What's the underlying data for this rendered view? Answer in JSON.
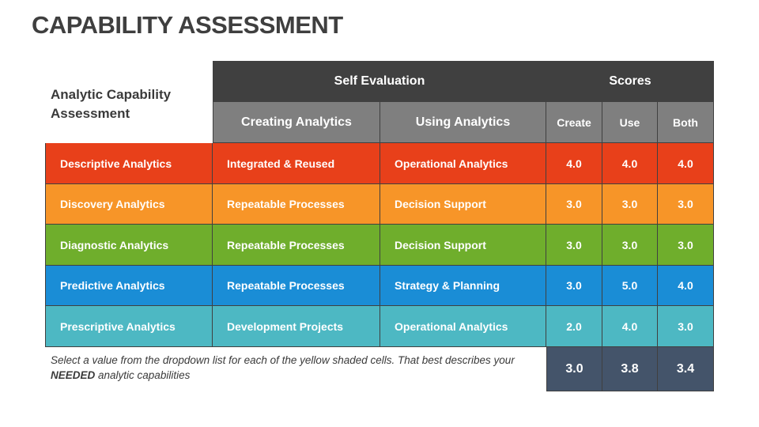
{
  "title": "CAPABILITY ASSESSMENT",
  "side_heading": "Analytic Capability Assessment",
  "headers": {
    "self_evaluation": "Self Evaluation",
    "scores": "Scores",
    "creating": "Creating Analytics",
    "using": "Using Analytics",
    "create": "Create",
    "use": "Use",
    "both": "Both"
  },
  "rows": [
    {
      "name": "Descriptive Analytics",
      "creating": "Integrated & Reused",
      "using": "Operational Analytics",
      "create": "4.0",
      "use": "4.0",
      "both": "4.0",
      "color": "#e8401a"
    },
    {
      "name": "Discovery Analytics",
      "creating": "Repeatable Processes",
      "using": "Decision Support",
      "create": "3.0",
      "use": "3.0",
      "both": "3.0",
      "color": "#f79528"
    },
    {
      "name": "Diagnostic Analytics",
      "creating": "Repeatable Processes",
      "using": "Decision Support",
      "create": "3.0",
      "use": "3.0",
      "both": "3.0",
      "color": "#6fae2c"
    },
    {
      "name": "Predictive Analytics",
      "creating": "Repeatable Processes",
      "using": "Strategy & Planning",
      "create": "3.0",
      "use": "5.0",
      "both": "4.0",
      "color": "#1a8dd6"
    },
    {
      "name": "Prescriptive Analytics",
      "creating": "Development Projects",
      "using": "Operational Analytics",
      "create": "2.0",
      "use": "4.0",
      "both": "3.0",
      "color": "#4db8c3"
    }
  ],
  "totals": {
    "create": "3.0",
    "use": "3.8",
    "both": "3.4"
  },
  "note": {
    "part1": "Select a value from the dropdown list for each of the yellow shaded cells. That best describes your ",
    "emphasis": "NEEDED",
    "part2": " analytic capabilities"
  }
}
